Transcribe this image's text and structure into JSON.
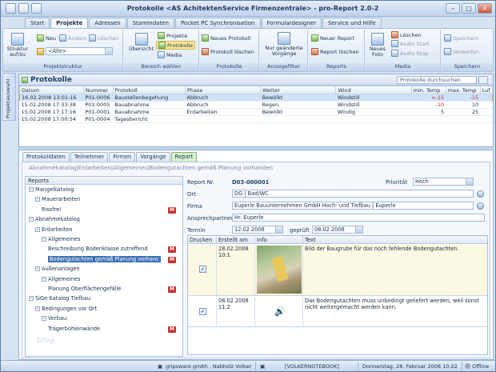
{
  "window": {
    "title": "Protokolle <AS AchitektenService Firmenzentrale> - pro-Report 2.0-2"
  },
  "tabs": [
    "Start",
    "Projekte",
    "Adressen",
    "Stammdaten",
    "Pocket PC Synchronisation",
    "Formulardesigner",
    "Service und Hilfe"
  ],
  "active_tab": "Projekte",
  "ribbon": {
    "projektstruktur": {
      "label": "Projektstruktur",
      "struktur": "Struktur auf/zu",
      "neu": "Neu",
      "andern": "Ändern",
      "loschen": "Löschen",
      "filter": "<Alle>"
    },
    "bereich": {
      "label": "Bereich wählen",
      "ubersicht": "Übersicht",
      "projekte": "Projekte",
      "protokolle": "Protokolle",
      "media": "Media"
    },
    "protokolle": {
      "label": "Protokolle",
      "neues": "Neues Protokoll",
      "loschen": "Protokoll löschen"
    },
    "anzeigefilter": {
      "label": "Anzeigefilter",
      "nur": "Nur geänderte Vorgänge"
    },
    "reports": {
      "label": "Reports",
      "neuer": "Neuer Report",
      "loschen": "Report löschen"
    },
    "media": {
      "label": "Media",
      "neues": "Neues Foto",
      "loschen": "Löschen",
      "audio_start": "Audio Start",
      "audio_stop": "Audio Stop"
    },
    "speichern": {
      "label": "Speichern",
      "speichern": "Speichern",
      "verwerfen": "Verwerfen"
    }
  },
  "sidebar": {
    "label": "Projektauswahl"
  },
  "protokolle": {
    "title": "Protokolle",
    "search_placeholder": "Protokolle durchsuchen",
    "columns": [
      "Datum",
      "Nummer",
      "Protokoll",
      "Phase",
      "Wetter",
      "Wind",
      "min. Temp",
      "max. Temp",
      "Luf"
    ],
    "rows": [
      [
        "16.02.2008 13:01:16",
        "P01-0006",
        "Baustellenbegehung",
        "Abbruch",
        "Bewölkt",
        "Windstill",
        "<-15",
        "-15",
        ""
      ],
      [
        "15.02.2008 17:33:38",
        "P01-0005",
        "Bauabnahme",
        "Abbruch",
        "Regen",
        "Windstill",
        "-10",
        "10",
        ""
      ],
      [
        "15.02.2008 17:17:16",
        "P01-0001",
        "Bauabnahme",
        "Erdarbeiten",
        "Bewölkt",
        "Windig",
        "5",
        "25",
        ""
      ],
      [
        "15.02.2008 17:00:54",
        "P01-0004",
        "Tagesbericht",
        "",
        "",
        "",
        "",
        "",
        ""
      ]
    ]
  },
  "detail_tabs": [
    "Protokolldaten",
    "Teilnehmer",
    "Firmen",
    "Vorgänge",
    "Report"
  ],
  "active_detail_tab": "Report",
  "breadcrumb": "Abnahmekatalog|Erdarbeiten|Allgemeines|Bodengutachten gemäß Planung vorhanden",
  "tree": {
    "header": "Reports",
    "nodes": [
      {
        "label": "Mangelkatalog",
        "level": 0,
        "pm": "-"
      },
      {
        "label": "Mauerarbeiten",
        "level": 1,
        "pm": "-"
      },
      {
        "label": "Rissfrei",
        "level": 2,
        "badge": "M"
      },
      {
        "label": "Abnahmekatalog",
        "level": 0,
        "pm": "-"
      },
      {
        "label": "Erdarbeiten",
        "level": 1,
        "pm": "-"
      },
      {
        "label": "Allgemeines",
        "level": 2,
        "pm": "-"
      },
      {
        "label": "Beschreibung Bodenklasse zutreffend",
        "level": 3,
        "badge": "M"
      },
      {
        "label": "Bodengutachten gemäß Planung vorhanc",
        "level": 3,
        "badge": "M",
        "selected": true
      },
      {
        "label": "Außenanlagen",
        "level": 1,
        "pm": "-"
      },
      {
        "label": "Allgemeines",
        "level": 2,
        "pm": "-"
      },
      {
        "label": "Planung Oberflächengefälle",
        "level": 3,
        "badge": "M"
      },
      {
        "label": "SiGe-Katalog Tiefbau",
        "level": 0,
        "pm": "-"
      },
      {
        "label": "Bedingungen vor Ort",
        "level": 1,
        "pm": "-"
      },
      {
        "label": "Verbau",
        "level": 2,
        "pm": "-"
      },
      {
        "label": "Trägerbohlenwände",
        "level": 3,
        "badge": "M"
      }
    ],
    "watermark": "blog"
  },
  "form": {
    "report_nr_label": "Report Nr.",
    "report_nr": "D03-000001",
    "prioritat_label": "Priorität",
    "prioritat": "Hoch",
    "ort_label": "Ort",
    "ort": "DG | Bad/WC",
    "firma_label": "Firma",
    "firma": "Euperle Bauunternehmen GmbH Hoch- und Tiefbau | Euperle",
    "ansprech_label": "Ansprechpartner",
    "ansprech": "Hr. Euperle",
    "termin_label": "Termin",
    "termin": "12.02.2008",
    "gepruft_label": "geprüft",
    "gepruft": "08.02.2008"
  },
  "media_table": {
    "columns": [
      "Drucken",
      "Erstellt am",
      "Info",
      "Text"
    ],
    "rows": [
      {
        "date": "28.02.2008 10:1",
        "text": "Bild der Baugrube für das noch fehlende Bodengutachten."
      },
      {
        "date": "08.02.2008 11:2",
        "text": "Das Bodengutachten muss unbedingt geliefert werden, weil sonst nicht weitergemacht werden kann."
      }
    ]
  },
  "status": {
    "company": "gripsware gmbh , Nabholz  Volker",
    "computer": "[VOLKERNOTEBOOK]",
    "datetime": "Donnerstag, 28. Februar 2008 10:22",
    "online": "Offline"
  }
}
